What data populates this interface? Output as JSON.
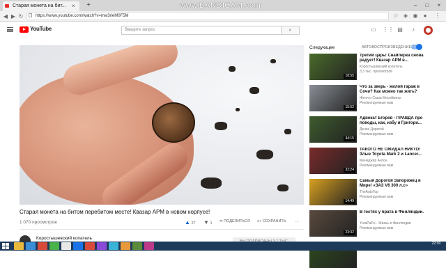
{
  "browser": {
    "tab_title": "Старая монета на бит...",
    "tab_close": "×",
    "new_tab": "+",
    "watermark": "www.BANDICAM.com",
    "url": "https://www.youtube.com/watch?v=mw3rieM0F5M",
    "window_minimize": "–",
    "window_maximize": "□",
    "window_close": "×"
  },
  "header": {
    "logo_text": "YouTube",
    "search_placeholder": "Введите запрос",
    "search_icon": "search-icon",
    "icons": [
      "video-camera-icon",
      "apps-grid-icon",
      "chat-icon",
      "bell-icon"
    ]
  },
  "video": {
    "title": "Старая монета на битом перебитом месте! Квазар АРМ в новом корпусе!",
    "views": "1 070 просмотров",
    "likes": "27",
    "dislikes": "1",
    "share_label": "ПОДЕЛИТЬСЯ",
    "save_label": "СОХРАНИТЬ",
    "more_label": "...",
    "channel_name": "Коростышевский копатель",
    "subscribe_label": "ВЫ ПОДПИСАНЫ  3,7 ТЫС."
  },
  "sidebar": {
    "next_label": "Следующее",
    "autoplay_label": "АВТОВОСПРОИЗВЕДЕНИЕ",
    "autoplay_on": true,
    "items": [
      {
        "title": "Третий царь! Снайперка снова радует! Квазар АРМ в...",
        "channel": "Коростышевский копатель",
        "meta": "3,3 тыс. просмотров",
        "duration": "18:55",
        "thumb_color": "#4a6b2a"
      },
      {
        "title": "Что за зверь - жилой гараж в Сочи? Как можно так жить?",
        "channel": "Женя и Саша Мосейкины",
        "meta": "Рекомендуемые вам",
        "duration": "15:52",
        "thumb_color": "#8a8f96"
      },
      {
        "title": "Адвокат Егоров - ПРАВДА про поводы, как, избу и Григори...",
        "channel": "Денис Дорогой",
        "meta": "Рекомендуемые вам",
        "duration": "44:15",
        "thumb_color": "#3e5c2e"
      },
      {
        "title": "ТАКОГО НЕ ОЖИДАЛ НИКТО! Злые Toyota Mark 2 и Lancer...",
        "channel": "Менеджер Антон",
        "meta": "Рекомендуемые вам",
        "duration": "32:24",
        "thumb_color": "#7a2a2a"
      },
      {
        "title": "Самый Дорогой Запорожец в Мире! «ЗАЗ V6 300 л.с»",
        "channel": "TheAutoTop",
        "meta": "Рекомендуемые вам",
        "duration": "14:49",
        "thumb_color": "#d8a020"
      },
      {
        "title": "В гостях у брата в Финляндии.",
        "channel": "YuraPaPu - Жизнь в Финляндии",
        "meta": "Рекомендуемые вам",
        "duration": "23:32",
        "thumb_color": "#5a4a3e"
      },
      {
        "title": "Молодой царёк и анонс Большого царя. Копаем в...",
        "channel": "",
        "meta": "",
        "duration": "",
        "thumb_color": "#2e4a1e"
      }
    ]
  },
  "taskbar": {
    "clock_time": "22:30",
    "clock_date": "",
    "icon_colors": [
      "#e8b93a",
      "#3a8fd8",
      "#d84a3a",
      "#4ab34a",
      "#e8e8e8",
      "#1a73e8",
      "#d84a3a",
      "#8a4ad8",
      "#3ab3d8",
      "#e89a3a",
      "#5a8a3a",
      "#c03a8a"
    ]
  }
}
